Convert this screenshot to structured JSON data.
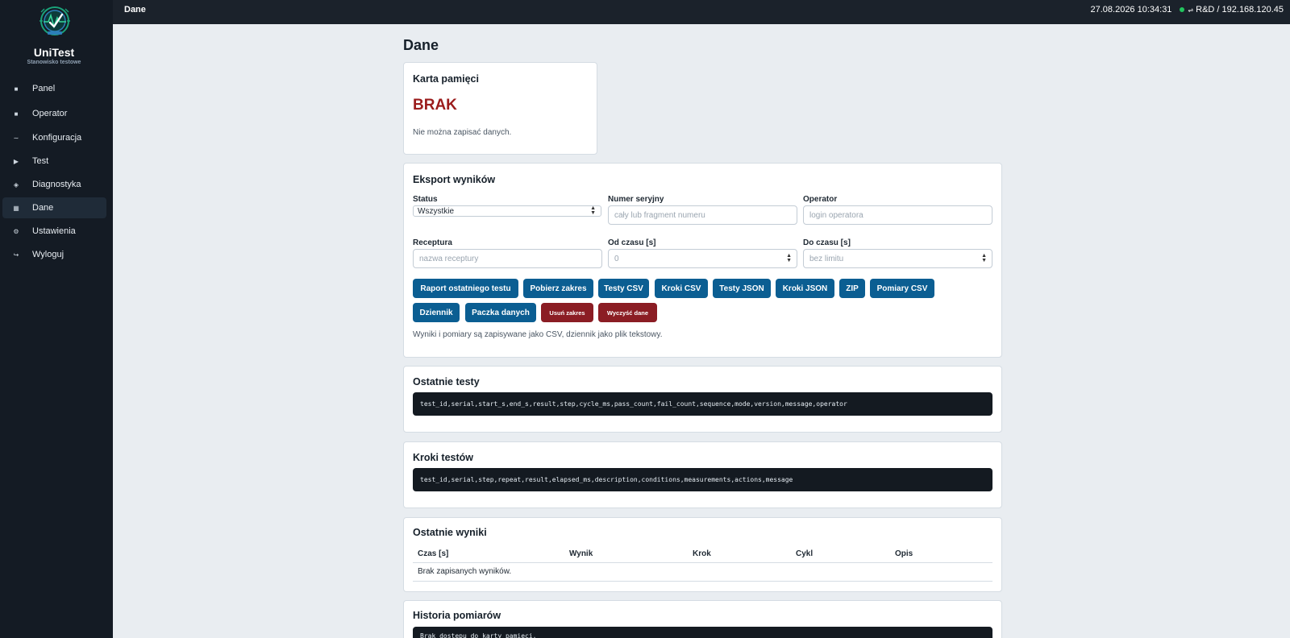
{
  "app": {
    "name": "UniTest",
    "subtitle": "Stanowisko testowe"
  },
  "sidebar": {
    "items": [
      {
        "label": "Panel",
        "icon": "square-icon"
      },
      {
        "label": "Operator",
        "icon": "square-icon"
      },
      {
        "label": "Konfiguracja",
        "icon": "tilde-icon"
      },
      {
        "label": "Test",
        "icon": "play-icon"
      },
      {
        "label": "Diagnostyka",
        "icon": "diamond-icon"
      },
      {
        "label": "Dane",
        "icon": "grid-icon",
        "active": true
      },
      {
        "label": "Ustawienia",
        "icon": "gear-icon"
      },
      {
        "label": "Wyloguj",
        "icon": "logout-icon"
      }
    ]
  },
  "topbar": {
    "title": "Dane",
    "datetime": "27.08.2026 10:34:31",
    "connection": "R&D / 192.168.120.45",
    "status_color": "#22c55e"
  },
  "page": {
    "title": "Dane"
  },
  "memory_card": {
    "title": "Karta pamięci",
    "status": "BRAK",
    "status_color": "#9b1c1c",
    "message": "Nie można zapisać danych."
  },
  "export": {
    "title": "Eksport wyników",
    "fields": {
      "status": {
        "label": "Status",
        "value": "Wszystkie"
      },
      "serial": {
        "label": "Numer seryjny",
        "placeholder": "cały lub fragment numeru"
      },
      "operator": {
        "label": "Operator",
        "placeholder": "login operatora"
      },
      "recipe": {
        "label": "Receptura",
        "placeholder": "nazwa receptury"
      },
      "from": {
        "label": "Od czasu [s]",
        "value": "0"
      },
      "to": {
        "label": "Do czasu [s]",
        "placeholder": "bez limitu"
      }
    },
    "buttons_row1": [
      "Raport ostatniego testu",
      "Pobierz zakres",
      "Testy CSV",
      "Kroki CSV",
      "Testy JSON",
      "Kroki JSON",
      "ZIP",
      "Pomiary CSV"
    ],
    "buttons_row2": [
      "Dziennik",
      "Paczka danych",
      "Usuń zakres",
      "Wyczyść dane"
    ],
    "note": "Wyniki i pomiary są zapisywane jako CSV, dziennik jako plik tekstowy."
  },
  "recent_tests": {
    "title": "Ostatnie testy",
    "header_line": "test_id,serial,start_s,end_s,result,step,cycle_ms,pass_count,fail_count,sequence,mode,version,message,operator"
  },
  "test_steps": {
    "title": "Kroki testów",
    "header_line": "test_id,serial,step,repeat,result,elapsed_ms,description,conditions,measurements,actions,message"
  },
  "recent_results": {
    "title": "Ostatnie wyniki",
    "columns": [
      "Czas [s]",
      "Wynik",
      "Krok",
      "Cykl",
      "Opis"
    ],
    "empty_message": "Brak zapisanych wyników."
  },
  "measurement_history": {
    "title": "Historia pomiarów",
    "content": "Brak dostępu do karty pamięci."
  },
  "colors": {
    "primary_button": "#0b5e92",
    "danger_button": "#8b1d24",
    "sidebar_bg": "#141b24"
  }
}
